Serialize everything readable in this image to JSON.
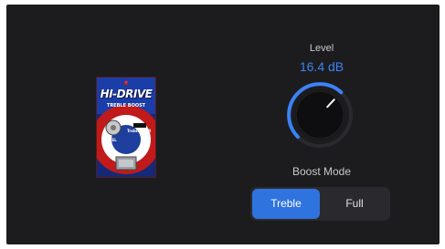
{
  "pedal": {
    "brand": "HI-DRIVE",
    "model": "TREBLE BOOST",
    "knob_label": "LEVEL",
    "switch_label": "Treble / Full"
  },
  "level": {
    "label": "Level",
    "value": "16.4 dB",
    "knob_fraction": 0.66
  },
  "boost_mode": {
    "label": "Boost Mode",
    "options": [
      "Treble",
      "Full"
    ],
    "selected": "Treble"
  },
  "colors": {
    "panel_background": "#1c1c1e",
    "accent": "#3b82f6",
    "selected_segment": "#2f73de",
    "segment_track": "#2a2a2e"
  }
}
